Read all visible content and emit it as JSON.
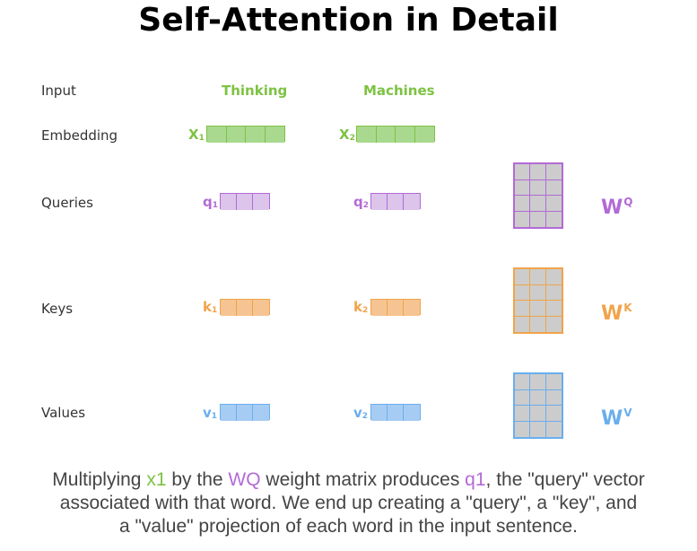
{
  "title": "Self-Attention in Detail",
  "rows": {
    "input": "Input",
    "embedding": "Embedding",
    "queries": "Queries",
    "keys": "Keys",
    "values": "Values"
  },
  "words": [
    "Thinking",
    "Machines"
  ],
  "embeddings": [
    {
      "base": "X",
      "sub": "1"
    },
    {
      "base": "X",
      "sub": "2"
    }
  ],
  "queries": [
    {
      "base": "q",
      "sub": "1"
    },
    {
      "base": "q",
      "sub": "2"
    }
  ],
  "keys": [
    {
      "base": "k",
      "sub": "1"
    },
    {
      "base": "k",
      "sub": "2"
    }
  ],
  "values": [
    {
      "base": "v",
      "sub": "1"
    },
    {
      "base": "v",
      "sub": "2"
    }
  ],
  "matrices": {
    "q": {
      "base": "W",
      "sup": "Q"
    },
    "k": {
      "base": "W",
      "sup": "K"
    },
    "v": {
      "base": "W",
      "sup": "V"
    }
  },
  "caption": {
    "line1": {
      "t1": "Multiplying ",
      "x1": "x1",
      "t2": " by the ",
      "wq": "WQ",
      "t3": " weight matrix produces ",
      "q1": "q1",
      "t4": ", the \"query\" vector"
    },
    "line2": "associated with that word. We end up creating a \"query\", a \"key\", and",
    "line3": "a \"value\" projection of each word in the input sentence."
  },
  "colors": {
    "green": "#7dc242",
    "green_fill": "#a9d98f",
    "purple": "#b36ad6",
    "purple_fill": "#dcc4ea",
    "orange": "#f0a44b",
    "orange_fill": "#f6c493",
    "blue": "#6aaeee",
    "blue_fill": "#a7ccf3"
  }
}
